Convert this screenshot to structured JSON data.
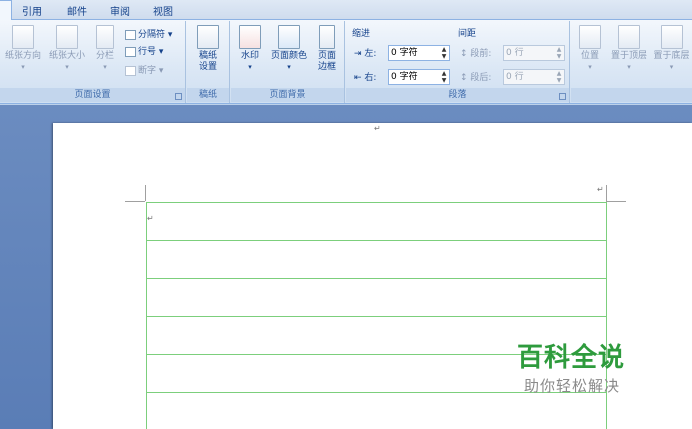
{
  "tabs": [
    "引用",
    "邮件",
    "审阅",
    "视图"
  ],
  "groups": {
    "page_setup": {
      "label": "页面设置",
      "orientation": "纸张方向",
      "size": "纸张大小",
      "columns": "分栏",
      "breaks": "分隔符",
      "line_numbers": "行号",
      "hyphenation": "断字"
    },
    "manuscript": {
      "label": "稿纸",
      "button_line1": "稿纸",
      "button_line2": "设置"
    },
    "page_background": {
      "label": "页面背景",
      "watermark": "水印",
      "page_color": "页面颜色",
      "page_border_line1": "页面",
      "page_border_line2": "边框"
    },
    "paragraph": {
      "label": "段落",
      "indent_title": "缩进",
      "indent_left_label": "左:",
      "indent_left_value": "0 字符",
      "indent_right_label": "右:",
      "indent_right_value": "0 字符",
      "spacing_title": "间距",
      "spacing_before_label": "段前:",
      "spacing_before_value": "0 行",
      "spacing_after_label": "段后:",
      "spacing_after_value": "0 行"
    },
    "arrange": {
      "position": "位置",
      "bring_front": "置于顶层",
      "send_back": "置于底层"
    }
  },
  "document": {
    "paragraph_mark": "↵"
  },
  "watermark": {
    "title": "百科全说",
    "subtitle": "助你轻松解决"
  }
}
